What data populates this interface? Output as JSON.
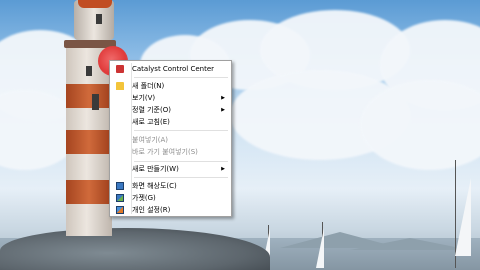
{
  "context_menu": {
    "items": [
      {
        "label": "Catalyst Control Center",
        "icon": "ati-icon",
        "enabled": true,
        "submenu": false
      },
      {
        "label": "새 폴더(N)",
        "icon": "new-folder-icon",
        "enabled": true,
        "submenu": false
      },
      {
        "label": "보기(V)",
        "enabled": true,
        "submenu": true
      },
      {
        "label": "정렬 기준(O)",
        "enabled": true,
        "submenu": true
      },
      {
        "label": "새로 고침(E)",
        "enabled": true,
        "submenu": false
      },
      {
        "label": "붙여넣기(A)",
        "enabled": false,
        "submenu": false
      },
      {
        "label": "바로 가기 붙여넣기(S)",
        "enabled": false,
        "submenu": false
      },
      {
        "label": "새로 만들기(W)",
        "enabled": true,
        "submenu": true
      },
      {
        "label": "화면 해상도(C)",
        "icon": "display-icon",
        "enabled": true,
        "submenu": false
      },
      {
        "label": "가젯(G)",
        "icon": "gadget-icon",
        "enabled": true,
        "submenu": false
      },
      {
        "label": "개인 설정(R)",
        "icon": "personalize-icon",
        "enabled": true,
        "submenu": false
      }
    ],
    "submenu_arrow": "▶"
  },
  "colors": {
    "menu_bg": "#ffffff",
    "menu_border": "#a0a0a0",
    "disabled_text": "#8d8d8d",
    "cursor_highlight": "#e03a3a"
  }
}
